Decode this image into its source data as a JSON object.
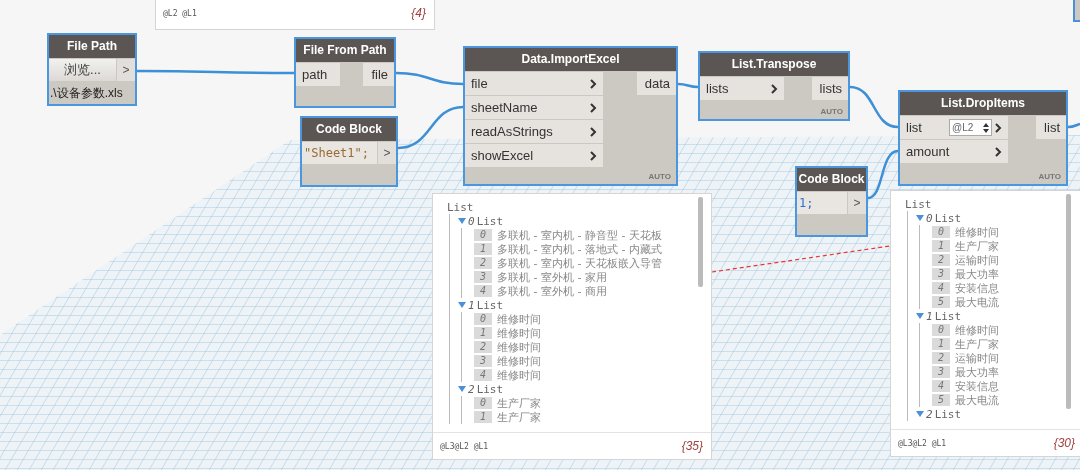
{
  "top_preview": {
    "levels": "@L2 @L1",
    "count": "{4}"
  },
  "nodes": [
    {
      "kind": "file-path",
      "title": "File Path",
      "selected": true,
      "button": "浏览...",
      "port": ">",
      "value": ".\\设备参数.xls"
    },
    {
      "kind": "function",
      "title": "File From Path",
      "selected": true,
      "inputs": [
        {
          "name": "path",
          "chevron": false
        }
      ],
      "outputs": [
        "file"
      ]
    },
    {
      "kind": "code",
      "title": "Code Block",
      "selected": true,
      "code": "\"Sheet1\";",
      "color": "#9a6b35",
      "port": ">"
    },
    {
      "kind": "function",
      "title": "Data.ImportExcel",
      "selected": true,
      "inputs": [
        {
          "name": "file",
          "chevron": true
        },
        {
          "name": "sheetName",
          "chevron": true
        },
        {
          "name": "readAsStrings",
          "chevron": true
        },
        {
          "name": "showExcel",
          "chevron": true
        }
      ],
      "outputs": [
        "data"
      ],
      "lacing": "AUTO"
    },
    {
      "kind": "function",
      "title": "List.Transpose",
      "selected": true,
      "inputs": [
        {
          "name": "lists",
          "chevron": true
        }
      ],
      "outputs": [
        "lists"
      ],
      "lacing": "AUTO"
    },
    {
      "kind": "function",
      "title": "List.DropItems",
      "selected": true,
      "inputs": [
        {
          "name": "list",
          "chevron": true,
          "list_level": "@L2"
        },
        {
          "name": "amount",
          "chevron": true
        }
      ],
      "outputs": [
        "list"
      ],
      "lacing": "AUTO"
    },
    {
      "kind": "code",
      "title": "Code Block",
      "selected": true,
      "code": "1;",
      "color": "#2e6fd0",
      "port": ">"
    }
  ],
  "previews": [
    {
      "root": "List",
      "groups": [
        {
          "index": "0",
          "label": "List",
          "expanded": true,
          "items": [
            {
              "index": "0",
              "text": "多联机 - 室内机 - 静音型 - 天花板"
            },
            {
              "index": "1",
              "text": "多联机 - 室内机 - 落地式 - 内藏式"
            },
            {
              "index": "2",
              "text": "多联机 - 室内机 - 天花板嵌入导管"
            },
            {
              "index": "3",
              "text": "多联机 - 室外机 - 家用"
            },
            {
              "index": "4",
              "text": "多联机 - 室外机 - 商用"
            }
          ]
        },
        {
          "index": "1",
          "label": "List",
          "expanded": true,
          "items": [
            {
              "index": "0",
              "text": "维修时间"
            },
            {
              "index": "1",
              "text": "维修时间"
            },
            {
              "index": "2",
              "text": "维修时间"
            },
            {
              "index": "3",
              "text": "维修时间"
            },
            {
              "index": "4",
              "text": "维修时间"
            }
          ]
        },
        {
          "index": "2",
          "label": "List",
          "expanded": true,
          "items": [
            {
              "index": "0",
              "text": "生产厂家"
            },
            {
              "index": "1",
              "text": "生产厂家"
            }
          ]
        }
      ],
      "levels": "@L3@L2 @L1",
      "count": "{35}"
    },
    {
      "root": "List",
      "groups": [
        {
          "index": "0",
          "label": "List",
          "expanded": true,
          "items": [
            {
              "index": "0",
              "text": "维修时间"
            },
            {
              "index": "1",
              "text": "生产厂家"
            },
            {
              "index": "2",
              "text": "运输时间"
            },
            {
              "index": "3",
              "text": "最大功率"
            },
            {
              "index": "4",
              "text": "安装信息"
            },
            {
              "index": "5",
              "text": "最大电流"
            }
          ]
        },
        {
          "index": "1",
          "label": "List",
          "expanded": true,
          "items": [
            {
              "index": "0",
              "text": "维修时间"
            },
            {
              "index": "1",
              "text": "生产厂家"
            },
            {
              "index": "2",
              "text": "运输时间"
            },
            {
              "index": "3",
              "text": "最大功率"
            },
            {
              "index": "4",
              "text": "安装信息"
            },
            {
              "index": "5",
              "text": "最大电流"
            }
          ]
        },
        {
          "index": "2",
          "label": "List",
          "expanded": true
        }
      ],
      "levels": "@L3@L2 @L1",
      "count": "{30}"
    }
  ]
}
